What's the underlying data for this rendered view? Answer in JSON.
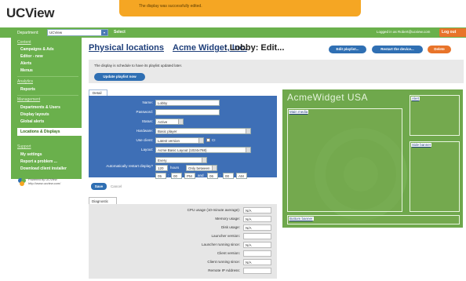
{
  "app": {
    "logo": "UCView"
  },
  "notice": "The display was successfully edited.",
  "topbar": {
    "department_label": "Department:",
    "department_value": "UCView",
    "select_label": "Select",
    "logged_in": "Logged in as Robert@ucview.com",
    "logout_label": "Log out"
  },
  "sidebar": {
    "content_head": "Content",
    "content_items": [
      "Campaigns & Ads",
      "Editor - new",
      "Alerts",
      "Menus"
    ],
    "analytics_head": "Analytics",
    "analytics_items": [
      "Reports"
    ],
    "management_head": "Management",
    "management_items": [
      "Departments & Users",
      "Display layouts",
      "Global alerts"
    ],
    "active_item": "Locations & Displays",
    "support_head": "Support",
    "support_items": [
      "My settings",
      "Report a problem ...",
      "Download client installer"
    ],
    "powered_line1": "Powered by UCView",
    "powered_line2": "http://www.ucview.com/"
  },
  "page": {
    "title_prefix": "Physical locations",
    "title_company": "Acme Widget, Inc.",
    "title_rest": ": Lobby: Edit...",
    "btn_edit_playlist": "Edit playlist...",
    "btn_restart": "Restart the device...",
    "btn_delete": "Delete"
  },
  "banner": {
    "text": "The display is schedule to have its playlist updated later.",
    "update_button": "Update playlist now"
  },
  "detail": {
    "tab_label": "Detail",
    "name_label": "Name:",
    "name_value": "Lobby",
    "password_label": "Password:",
    "password_value": "",
    "status_label": "Status:",
    "status_value": "Active",
    "hardware_label": "Hardware:",
    "hardware_value": "Basic player",
    "client_label": "Use client:",
    "client_value": "Latest version",
    "client_extra": "CI",
    "layout_label": "Layout:",
    "layout_value": "Acme Basic Layout (1024x768)",
    "restart_label": "Automatically restart display?",
    "restart_every": "Every",
    "restart_hours": "120",
    "restart_hours_unit": "hours",
    "restart_window": "Only between",
    "time1_h": "05",
    "time1_m": "00",
    "time1_ampm": "PM",
    "and_label": "and",
    "time2_h": "06",
    "time2_m": "00",
    "time2_ampm": "AM",
    "save_label": "Save",
    "cancel_label": "Cancel"
  },
  "diagnostic": {
    "tab_label": "Diagnostic",
    "rows": [
      {
        "label": "CPU usage (10-minute average):",
        "value": "N/A"
      },
      {
        "label": "Memory usage:",
        "value": "N/A"
      },
      {
        "label": "Disk usage:",
        "value": "N/A"
      },
      {
        "label": "Launcher version:",
        "value": ""
      },
      {
        "label": "Launcher running since:",
        "value": "N/A"
      },
      {
        "label": "Client version:",
        "value": ""
      },
      {
        "label": "Client running since:",
        "value": "N/A"
      },
      {
        "label": "Remote IP Address:",
        "value": ""
      }
    ]
  },
  "preview": {
    "title": "AcmeWidget USA",
    "zones": [
      "Main media",
      "Alert",
      "Side banner",
      "Bottom banner"
    ]
  },
  "colors": {
    "green": "#6ab04c",
    "blue": "#3e6fb6",
    "orange": "#e8742a",
    "notice": "#f5a623"
  }
}
